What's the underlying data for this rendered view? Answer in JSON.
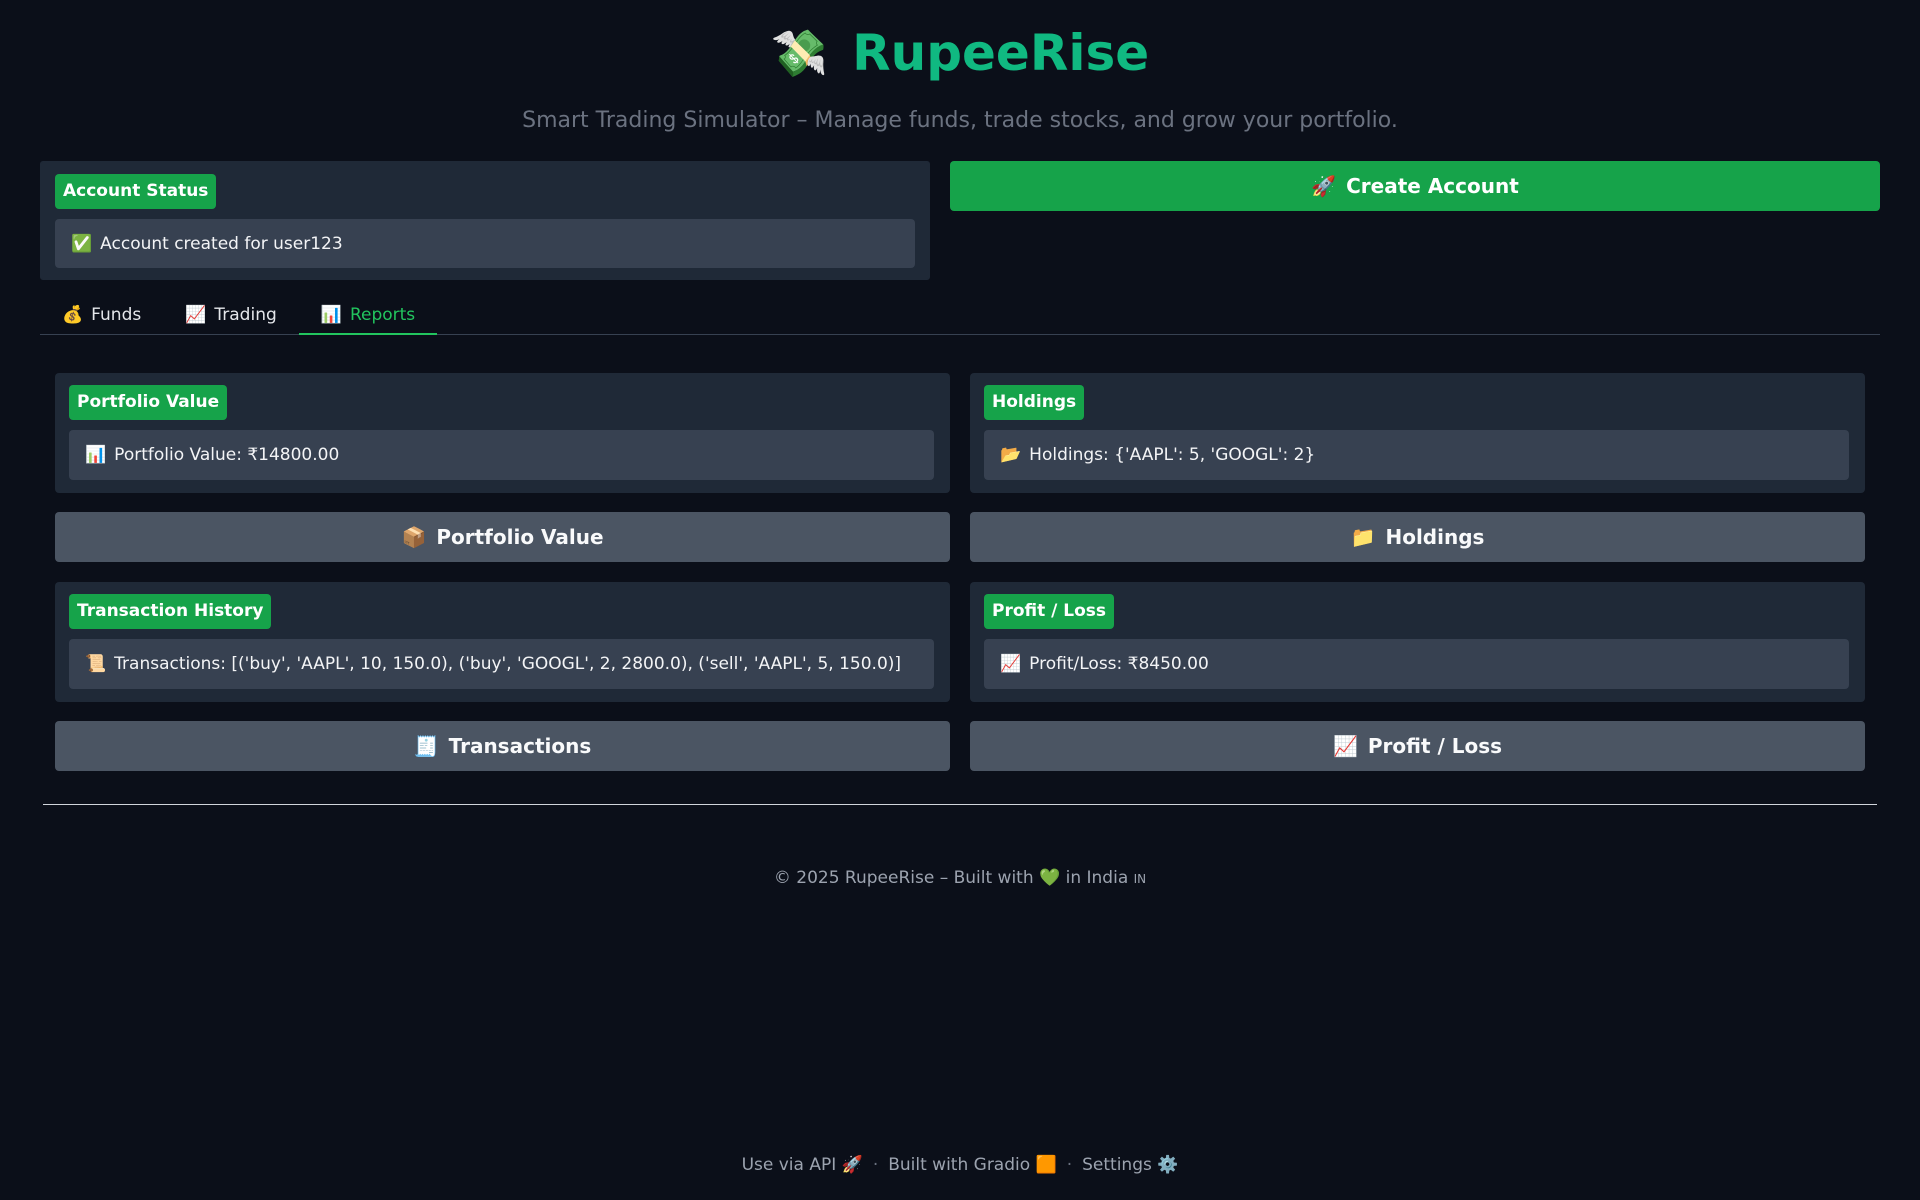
{
  "header": {
    "logo_icon": "💸",
    "title": "RupeeRise",
    "subtitle": "Smart Trading Simulator – Manage funds, trade stocks, and grow your portfolio."
  },
  "account_status": {
    "label": "Account Status",
    "icon": "✅",
    "value": "Account created for user123"
  },
  "create_account": {
    "icon": "🚀",
    "label": "Create Account"
  },
  "tabs": [
    {
      "icon": "💰",
      "label": "Funds"
    },
    {
      "icon": "📈",
      "label": "Trading"
    },
    {
      "icon": "📊",
      "label": "Reports",
      "active": true
    }
  ],
  "reports": {
    "portfolio": {
      "label": "Portfolio Value",
      "icon": "📊",
      "value": "Portfolio Value: ₹14800.00",
      "button_icon": "📦",
      "button_label": "Portfolio Value"
    },
    "holdings": {
      "label": "Holdings",
      "icon": "📂",
      "value": "Holdings: {'AAPL': 5, 'GOOGL': 2}",
      "button_icon": "📁",
      "button_label": "Holdings"
    },
    "transactions": {
      "label": "Transaction History",
      "icon": "📜",
      "value": "Transactions: [('buy', 'AAPL', 10, 150.0), ('buy', 'GOOGL', 2, 2800.0), ('sell', 'AAPL', 5, 150.0)]",
      "button_icon": "🧾",
      "button_label": "Transactions"
    },
    "profit_loss": {
      "label": "Profit / Loss",
      "icon": "📈",
      "value": "Profit/Loss: ₹8450.00",
      "button_icon": "📈",
      "button_label": "Profit / Loss"
    }
  },
  "footer": {
    "copyright_prefix": "© 2025 RupeeRise – Built with",
    "heart": "💚",
    "copyright_suffix": "in India",
    "flag": "IN"
  },
  "gradio_footer": {
    "api_label": "Use via API",
    "api_icon": "🚀",
    "built_label": "Built with Gradio",
    "built_icon": "🟧",
    "settings_label": "Settings",
    "settings_icon": "⚙️",
    "separator": "·"
  },
  "colors": {
    "background": "#0b0f19",
    "accent": "#16a34a",
    "brand": "#10b981",
    "card": "#1f2937",
    "button": "#4b5563"
  }
}
